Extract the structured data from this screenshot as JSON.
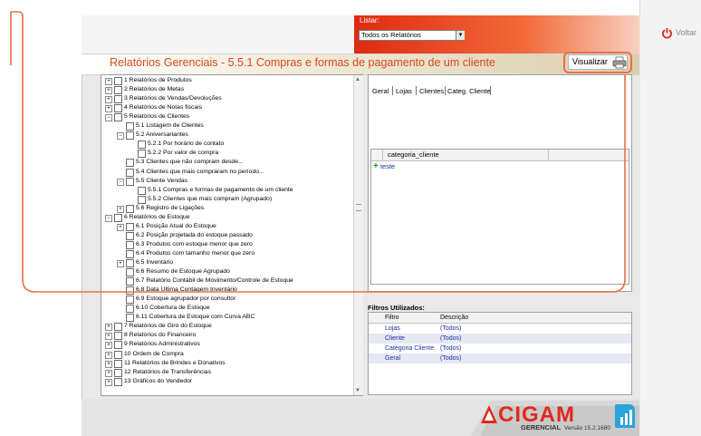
{
  "voltar_label": "Voltar",
  "listar": {
    "label": "Listar:",
    "selected": "Todos os Relatórios"
  },
  "title": "Relatórios Gerenciais - 5.5.1 Compras e formas de pagamento de um cliente",
  "visualizar_label": "Visualizar",
  "tree": [
    {
      "label": "1 Relatórios de Produtos",
      "exp": "+"
    },
    {
      "label": "2 Relatórios de Metas",
      "exp": "+"
    },
    {
      "label": "3 Relatórios de Vendas/Devoluções",
      "exp": "+"
    },
    {
      "label": "4 Relatórios de Notas fiscais",
      "exp": "+"
    },
    {
      "label": "5 Relatórios de Clientes",
      "exp": "-"
    },
    {
      "label": "5.1 Listagem de Clientes",
      "exp": ""
    },
    {
      "label": "5.2 Aniversariantes",
      "exp": "-"
    },
    {
      "label": "5.2.1 Por horário de contato",
      "exp": ""
    },
    {
      "label": "5.2.2 Por valor de compra",
      "exp": ""
    },
    {
      "label": "5.3 Clientes que não compram desde...",
      "exp": ""
    },
    {
      "label": "5.4 Clientes que mais compraram no período...",
      "exp": ""
    },
    {
      "label": "5.5 Cliente Vendas",
      "exp": "-"
    },
    {
      "label": "5.5.1 Compras e formas de pagamento de um cliente",
      "exp": ""
    },
    {
      "label": "5.5.2 Clientes que mais compram (Agrupado)",
      "exp": ""
    },
    {
      "label": "5.6 Registro de Ligações",
      "exp": "+"
    },
    {
      "label": "6 Relatórios de Estoque",
      "exp": "-"
    },
    {
      "label": "6.1 Posição Atual do Estoque",
      "exp": "+"
    },
    {
      "label": "6.2 Posição projetada do estoque passado",
      "exp": ""
    },
    {
      "label": "6.3 Produtos com estoque menor que zero",
      "exp": ""
    },
    {
      "label": "6.4 Produtos com tamanho menor que zero",
      "exp": ""
    },
    {
      "label": "6.5 Inventário",
      "exp": "+"
    },
    {
      "label": "6.6 Resumo de Estoque Agrupado",
      "exp": ""
    },
    {
      "label": "6.7 Relatório Contábil de Movimento/Controle de Estoque",
      "exp": ""
    },
    {
      "label": "6.8 Data Ultima Contagem Inventário",
      "exp": ""
    },
    {
      "label": "6.9 Estoque agrupador por consultor",
      "exp": ""
    },
    {
      "label": "6.10 Cobertura de Estoque",
      "exp": ""
    },
    {
      "label": "6.11 Cobertura de Estoque com Curva ABC",
      "exp": ""
    },
    {
      "label": "7 Relatórios de Giro do Estoque",
      "exp": "+"
    },
    {
      "label": "8 Relatórios do Financeiro",
      "exp": "+"
    },
    {
      "label": "9 Relatórios Administrativos",
      "exp": "+"
    },
    {
      "label": "10 Ordem de Compra",
      "exp": "+"
    },
    {
      "label": "11 Relatórios de Brindes e Donativos",
      "exp": "+"
    },
    {
      "label": "12 Relatórios de Transferências",
      "exp": "+"
    },
    {
      "label": "13 Gráficos do Vendedor",
      "exp": "+"
    }
  ],
  "tabs": [
    "Geral",
    "Lojas",
    "Clientes",
    "Categ. Cliente"
  ],
  "grid": {
    "header": "categoria_cliente",
    "row": "teste"
  },
  "filtros": {
    "title": "Filtros Utilizados:",
    "col_filtro": "Filtro",
    "col_descricao": "Descrição",
    "rows": [
      {
        "filtro": "Lojas",
        "descricao": "(Todos)"
      },
      {
        "filtro": "Cliente",
        "descricao": "(Todos)"
      },
      {
        "filtro": "Categoria Cliente",
        "descricao": "(Todos)"
      },
      {
        "filtro": "Geral",
        "descricao": "(Todos)"
      }
    ]
  },
  "logo": {
    "name": "CIGAM",
    "sub": "GERENCIAL",
    "version": "Versão 15.2.1680"
  },
  "colors": {
    "accent": "#e2281a",
    "callout": "#e8704a",
    "title": "#d94a1f"
  }
}
